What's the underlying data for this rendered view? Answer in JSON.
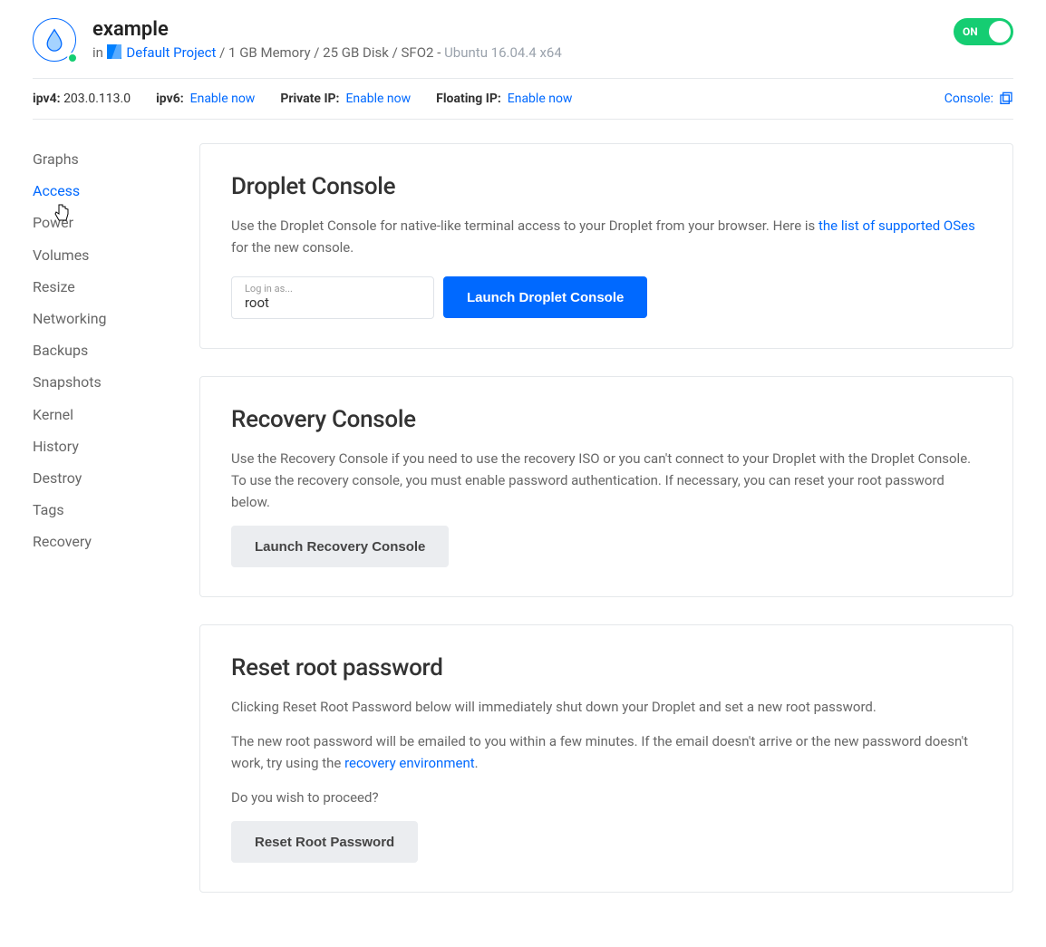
{
  "header": {
    "name": "example",
    "in_label": "in",
    "project_name": "Default Project",
    "specs": "1 GB Memory / 25 GB Disk / SFO2",
    "os": "Ubuntu 16.04.4 x64",
    "toggle_label": "ON"
  },
  "ipbar": {
    "ipv4_label": "ipv4:",
    "ipv4_value": "203.0.113.0",
    "ipv6_label": "ipv6:",
    "ipv6_action": "Enable now",
    "private_label": "Private IP:",
    "private_action": "Enable now",
    "floating_label": "Floating IP:",
    "floating_action": "Enable now",
    "console_label": "Console:"
  },
  "sidebar": {
    "items": [
      {
        "label": "Graphs"
      },
      {
        "label": "Access"
      },
      {
        "label": "Power"
      },
      {
        "label": "Volumes"
      },
      {
        "label": "Resize"
      },
      {
        "label": "Networking"
      },
      {
        "label": "Backups"
      },
      {
        "label": "Snapshots"
      },
      {
        "label": "Kernel"
      },
      {
        "label": "History"
      },
      {
        "label": "Destroy"
      },
      {
        "label": "Tags"
      },
      {
        "label": "Recovery"
      }
    ],
    "active_index": 1
  },
  "cards": {
    "droplet_console": {
      "title": "Droplet Console",
      "desc_a": "Use the Droplet Console for native-like terminal access to your Droplet from your browser. Here is ",
      "link_text": "the list of supported OSes",
      "desc_b": " for the new console.",
      "login_label": "Log in as...",
      "login_value": "root",
      "button": "Launch Droplet Console"
    },
    "recovery_console": {
      "title": "Recovery Console",
      "desc": "Use the Recovery Console if you need to use the recovery ISO or you can't connect to your Droplet with the Droplet Console. To use the recovery console, you must enable password authentication. If necessary, you can reset your root password below.",
      "button": "Launch Recovery Console"
    },
    "reset_password": {
      "title": "Reset root password",
      "desc1": "Clicking Reset Root Password below will immediately shut down your Droplet and set a new root password.",
      "desc2a": "The new root password will be emailed to you within a few minutes. If the email doesn't arrive or the new password doesn't work, try using the ",
      "desc2_link": "recovery environment",
      "desc2b": ".",
      "desc3": "Do you wish to proceed?",
      "button": "Reset Root Password"
    }
  }
}
